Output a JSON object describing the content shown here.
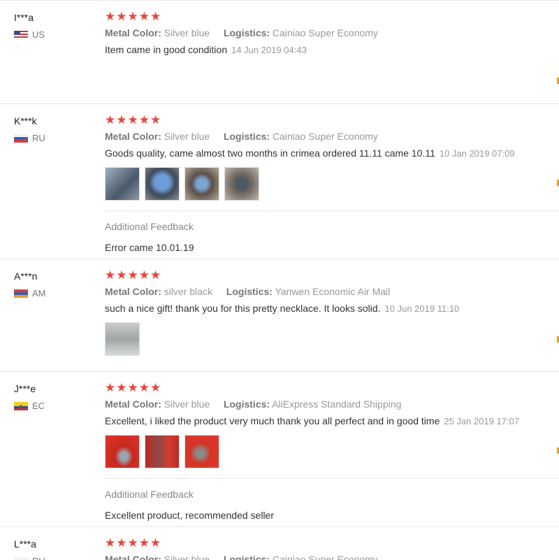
{
  "labels": {
    "metal_color": "Metal Color:",
    "logistics": "Logistics:",
    "additional_feedback": "Additional Feedback"
  },
  "reviews": [
    {
      "name": "I***a",
      "country": "US",
      "stars": "★★★★★",
      "metal_color": "Silver blue",
      "logistics": "Cainiao Super Economy",
      "comment": "Item came in good condition",
      "date": "14 Jun 2019 04:43"
    },
    {
      "name": "K***k",
      "country": "RU",
      "stars": "★★★★★",
      "metal_color": "Silver blue",
      "logistics": "Cainiao Super Economy",
      "comment": "Goods quality, came almost two months in crimea ordered 11.11 came 10.11",
      "date": "10 Jan 2019 07:09",
      "additional": "Error came 10.01.19"
    },
    {
      "name": "A***n",
      "country": "AM",
      "stars": "★★★★★",
      "metal_color": "silver black",
      "logistics": "Yanwen Economic Air Mail",
      "comment": "such a nice gift! thank you for this pretty necklace. It looks solid.",
      "date": "10 Jun 2019 11:10"
    },
    {
      "name": "J***e",
      "country": "EC",
      "stars": "★★★★★",
      "metal_color": "Silver blue",
      "logistics": "AliExpress Standard Shipping",
      "comment": "Excellent, i liked the product very much thank you all perfect and in good time",
      "date": "25 Jan 2019 17:07",
      "additional": "Excellent product, recommended seller"
    },
    {
      "name": "L***a",
      "country": "RU",
      "stars": "★★★★★",
      "metal_color": "Silver blue",
      "logistics": "Cainiao Super Economy"
    }
  ],
  "colors": {
    "star": "#e8453c",
    "border": "#e8e8e8",
    "muted": "#999999"
  }
}
